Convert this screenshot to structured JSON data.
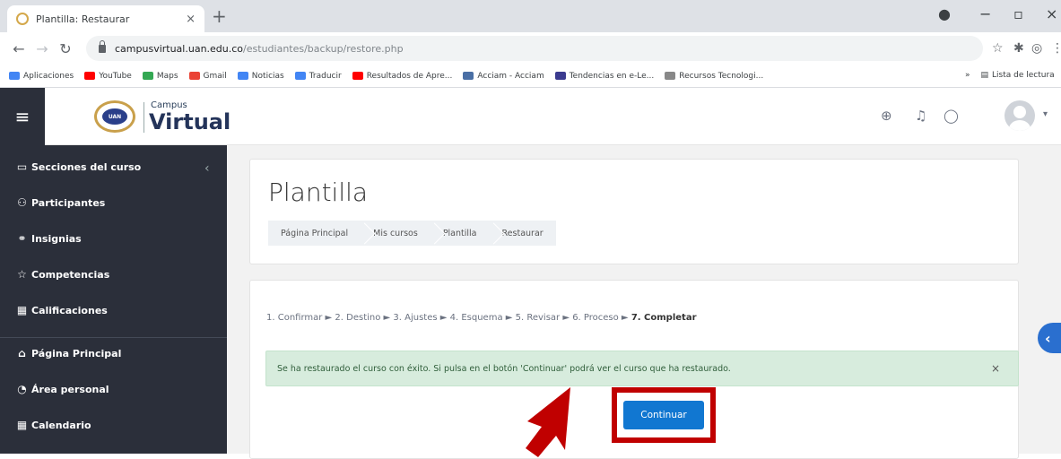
{
  "browser": {
    "tab_title": "Plantilla: Restaurar",
    "tab_close": "×",
    "new_tab": "+",
    "url_host": "campusvirtual.uan.edu.co",
    "url_path": "/estudiantes/backup/restore.php",
    "bookmarks": [
      {
        "label": "Aplicaciones",
        "color": "#4285f4"
      },
      {
        "label": "YouTube",
        "color": "#ff0000"
      },
      {
        "label": "Maps",
        "color": "#34a853"
      },
      {
        "label": "Gmail",
        "color": "#ea4335"
      },
      {
        "label": "Noticias",
        "color": "#4285f4"
      },
      {
        "label": "Traducir",
        "color": "#4285f4"
      },
      {
        "label": "Resultados de Apre...",
        "color": "#ff0000"
      },
      {
        "label": "Acciam - Acciam",
        "color": "#4a6fa5"
      },
      {
        "label": "Tendencias en e-Le...",
        "color": "#3b3b8f"
      },
      {
        "label": "Recursos Tecnologi...",
        "color": "#888888"
      }
    ],
    "bookmarks_more": "»",
    "reading_list": "Lista de lectura"
  },
  "header": {
    "logo_badge": "UAN",
    "logo_small": "Campus",
    "logo_big": "Virtual"
  },
  "sidebar": {
    "items": [
      {
        "label": "Secciones del curso",
        "icon": "folder-icon",
        "glyph": "▭"
      },
      {
        "label": "Participantes",
        "icon": "users-icon",
        "glyph": "⚇"
      },
      {
        "label": "Insignias",
        "icon": "badge-icon",
        "glyph": "⚭"
      },
      {
        "label": "Competencias",
        "icon": "star-icon",
        "glyph": "☆"
      },
      {
        "label": "Calificaciones",
        "icon": "table-icon",
        "glyph": "▦"
      },
      {
        "label": "Página Principal",
        "icon": "home-icon",
        "glyph": "⌂"
      },
      {
        "label": "Área personal",
        "icon": "dashboard-icon",
        "glyph": "◔"
      },
      {
        "label": "Calendario",
        "icon": "calendar-icon",
        "glyph": "▦"
      }
    ]
  },
  "main": {
    "title": "Plantilla",
    "breadcrumb": [
      "Página Principal",
      "Mis cursos",
      "Plantilla",
      "Restaurar"
    ],
    "steps": "1. Confirmar ► 2. Destino ► 3. Ajustes ► 4. Esquema ► 5. Revisar ► 6. Proceso ► ",
    "steps_current": "7. Completar",
    "alert": "Se ha restaurado el curso con éxito. Si pulsa en el botón 'Continuar' podrá ver el curso que ha restaurado.",
    "alert_close": "×",
    "continue_label": "Continuar"
  },
  "colors": {
    "sidebar": "#2b2f3a",
    "primary_button": "#1177d1",
    "highlight": "#c00000",
    "alert_bg": "#d7ecdd"
  }
}
